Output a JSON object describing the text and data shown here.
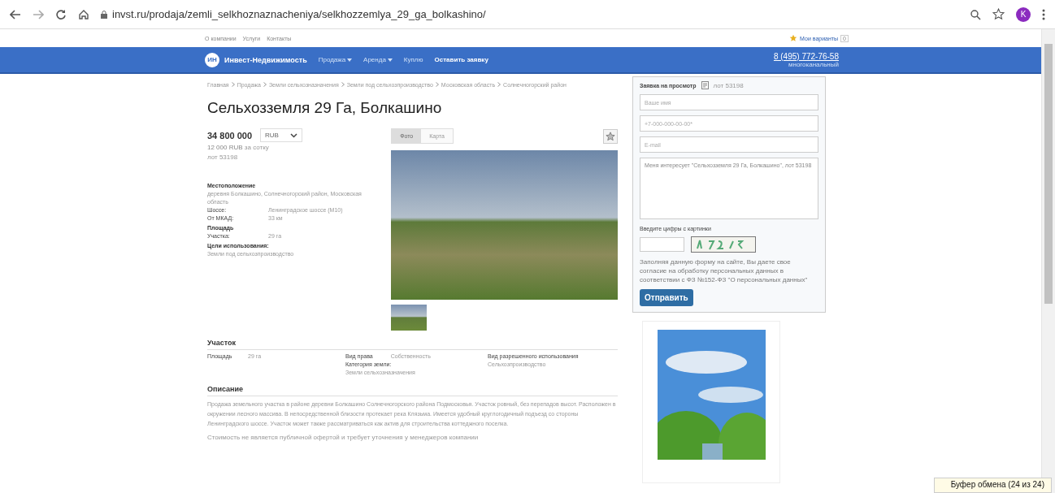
{
  "browser": {
    "url": "invst.ru/prodaja/zemli_selkhoznaznacheniya/selkhozzemlya_29_ga_bolkashino/",
    "profile_initial": "K"
  },
  "top_links": [
    "О компании",
    "Услуги",
    "Контакты"
  ],
  "favorites": {
    "label": "Мои варианты",
    "count": "0"
  },
  "nav": {
    "logo": "ИН",
    "brand": "Инвест-Недвижимость",
    "items": [
      {
        "label": "Продажа",
        "dropdown": true
      },
      {
        "label": "Аренда",
        "dropdown": true
      },
      {
        "label": "Куплю",
        "dropdown": false
      },
      {
        "label": "Оставить заявку",
        "dropdown": false
      }
    ],
    "phone": "8 (495) 772-76-58",
    "phone_note": "многоканальный"
  },
  "breadcrumbs": [
    "Главная",
    "Продажа",
    "Земли сельхозназначения",
    "Земли под сельхозпроизводство",
    "Московская область",
    "Солнечногорский район"
  ],
  "title": "Сельхозземля 29 Га, Болкашино",
  "price": {
    "amount": "34 800 000",
    "currency": "RUB",
    "per_unit": "12 000 RUB",
    "per_unit_note": "за сотку",
    "lot": "лот 53198"
  },
  "details": [
    {
      "kind": "heading",
      "text": "Местоположение"
    },
    {
      "kind": "text",
      "text": "деревня Болкашино, Солнечногорский район, Московская область"
    },
    {
      "kind": "pair",
      "label": "Шоссе:",
      "value": "Ленинградское шоссе (М10)"
    },
    {
      "kind": "pair",
      "label": "От МКАД:",
      "value": "33 км"
    },
    {
      "kind": "heading",
      "text": "Площадь"
    },
    {
      "kind": "pair",
      "label": "Участка:",
      "value": "29 га"
    },
    {
      "kind": "heading",
      "text": "Цели использования:"
    },
    {
      "kind": "text",
      "text": "Земли под сельхозпроизводство"
    }
  ],
  "gallery_tabs": [
    {
      "label": "Фото",
      "selected": true
    },
    {
      "label": "Карта",
      "selected": false
    }
  ],
  "plot": {
    "heading": "Участок",
    "area_label": "Площадь",
    "area_value": "29 га",
    "right_label": "Вид права",
    "right_value": "Собственность",
    "category_label": "Категория земли:",
    "category_value": "Земли сельхозназначения",
    "use_label": "Вид разрешенного использования",
    "use_value": "Сельхозпроизводство"
  },
  "description": {
    "heading": "Описание",
    "text": "Продажа земельного участка в районе деревни Болкашино Солнечногорского района Подмосковья. Участок ровный, без перепадов высот. Расположен в окружении лесного массива. В непосредственной близости протекает река Клязьма. Имеется удобный круглогодичный подъезд со стороны Ленинградского шоссе. Участок может также рассматриваться как актив для строительства коттеджного поселка.",
    "note": "Стоимость не является публичной офертой и требует уточнения у менеджеров компании"
  },
  "form": {
    "title": "Заявка на просмотр",
    "lot": "лот 53198",
    "fields": [
      {
        "placeholder": "Ваше имя"
      },
      {
        "placeholder": "+7-000-000-00-00*"
      },
      {
        "placeholder": "E-mail"
      }
    ],
    "message": "Меня интересует \"Сельхозземля 29 Га, Болкашино\", лот 53198",
    "captcha_label": "Введите цифры с картинки",
    "consent": "Заполняя данную форму на сайте, Вы даете свое согласие на обработку персональных данных в соответствии с ФЗ №152-ФЗ \"О персональных данных\"",
    "submit": "Отправить"
  },
  "clipboard": "Буфер обмена (24 из 24)"
}
